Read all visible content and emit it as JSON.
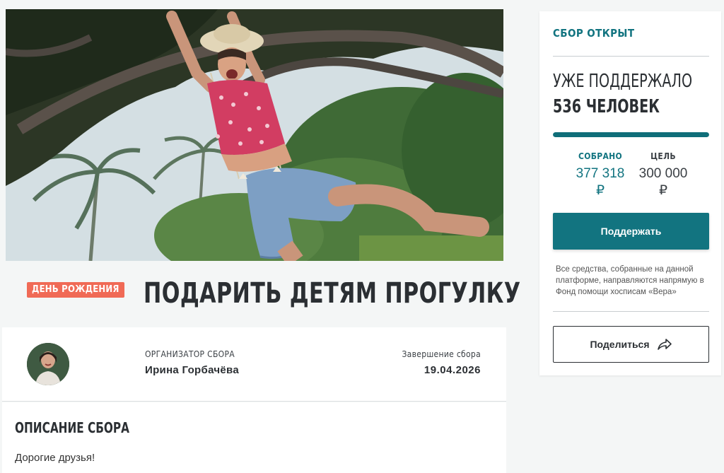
{
  "campaign": {
    "badge": "ДЕНЬ РОЖДЕНИЯ",
    "title": "ПОДАРИТЬ ДЕТЯМ ПРОГУЛКУ"
  },
  "organizer": {
    "label": "ОРГАНИЗАТОР СБОРА",
    "name": "Ирина Горбачёва",
    "end_label": "Завершение сбора",
    "end_date": "19.04.2026"
  },
  "description": {
    "title": "ОПИСАНИЕ СБОРА",
    "text": "Дорогие друзья!"
  },
  "sidebar": {
    "status": "СБОР ОТКРЫТ",
    "supporters_line1": "УЖЕ ПОДДЕРЖАЛО",
    "supporters_line2": "536 ЧЕЛОВЕК",
    "progress_fraction": 1.0,
    "collected_label": "СОБРАНО",
    "collected_value": "377 318",
    "goal_label": "ЦЕЛЬ",
    "goal_value": "300 000",
    "currency": "₽",
    "support_button": "Поддержать",
    "note": "Все средства, собранные на данной платформе, направляются напрямую в Фонд помощи хосписам «Вера»",
    "share_button": "Поделиться"
  },
  "colors": {
    "accent": "#127480",
    "badge": "#f06a56"
  }
}
